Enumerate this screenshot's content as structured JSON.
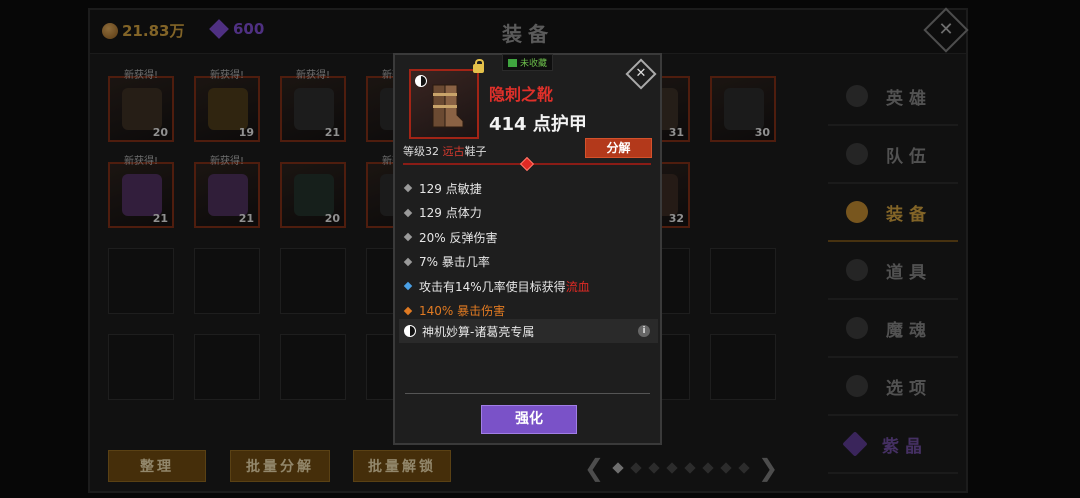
{
  "header": {
    "gold": "21.83万",
    "gems": "600",
    "title": "装备"
  },
  "grid": {
    "new_label": "新获得!",
    "items": [
      {
        "count": "20",
        "new": true,
        "color": "#3b2e22"
      },
      {
        "count": "19",
        "new": true,
        "color": "#4a3a1a"
      },
      {
        "count": "21",
        "new": true,
        "color": "#2c2c2c"
      },
      {
        "count": "",
        "new": true,
        "color": "#2a2a2a"
      },
      {
        "count": "31",
        "new": false,
        "color": "#3a2e26"
      },
      {
        "count": "30",
        "new": false,
        "color": "#2a2a2a"
      },
      {
        "count": "21",
        "new": true,
        "color": "#4d2e5c"
      },
      {
        "count": "21",
        "new": true,
        "color": "#4a2f58"
      },
      {
        "count": "20",
        "new": false,
        "color": "#22302a"
      },
      {
        "count": "",
        "new": true,
        "color": "#2a2a2a"
      },
      {
        "count": "32",
        "new": false,
        "color": "#3a2a22"
      }
    ]
  },
  "sidebar": {
    "items": [
      {
        "label": "英雄"
      },
      {
        "label": "队伍"
      },
      {
        "label": "装备"
      },
      {
        "label": "道具"
      },
      {
        "label": "魔魂"
      },
      {
        "label": "选项"
      },
      {
        "label": "紫晶"
      }
    ]
  },
  "bottom": {
    "sort": "整理",
    "batch_dismantle": "批量分解",
    "batch_unlock": "批量解锁"
  },
  "tooltip": {
    "collect_badge": "未收藏",
    "name": "隐刺之靴",
    "armor": "414 点护甲",
    "level": "等级32",
    "type_red": "远古",
    "slot": "鞋子",
    "dismantle": "分解",
    "stats": [
      "129 点敏捷",
      "129 点体力",
      "20% 反弹伤害",
      "7% 暴击几率"
    ],
    "special_prefix": "攻击有14%几率使目标获得",
    "special_effect": "流血",
    "orange_stat": "140% 暴击伤害",
    "set_name": "神机妙算-诸葛亮专属",
    "info": "i",
    "strengthen": "强化"
  },
  "colors": {
    "rarity_red": "#a22416",
    "accent_gold": "#c89a3c",
    "strengthen_purple": "#7a52c8",
    "dismantle_red": "#b3391b"
  }
}
